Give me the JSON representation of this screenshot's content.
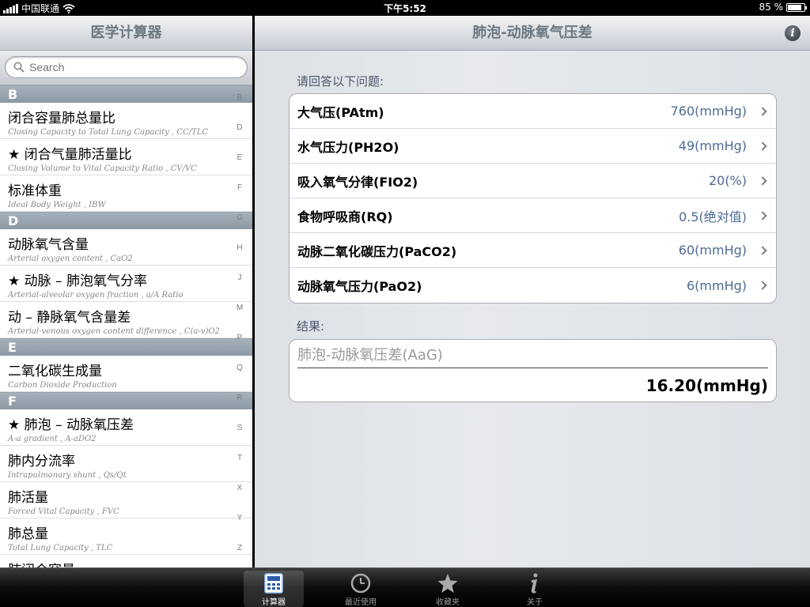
{
  "status": {
    "carrier": "中国联通",
    "time": "下午5:52",
    "battery": "85 %",
    "battery_level": 0.85
  },
  "master": {
    "title": "医学计算器",
    "search_placeholder": "Search",
    "sections": [
      {
        "letter": "B",
        "items": [
          {
            "title": "闭合容量肺总量比",
            "subtitle": "Closing Capacity to Total Lung Capacity , CC/TLC"
          },
          {
            "title": "★ 闭合气量肺活量比",
            "subtitle": "Closing Volume to Vital Capacity Ratio , CV/VC"
          },
          {
            "title": "标准体重",
            "subtitle": "Ideal Body Weight , IBW"
          }
        ]
      },
      {
        "letter": "D",
        "items": [
          {
            "title": "动脉氧气含量",
            "subtitle": "Arterial oxygen content , CaO2"
          },
          {
            "title": "★ 动脉 – 肺泡氧气分率",
            "subtitle": "Arterial-alveolar oxygen fraction , a/A Ratio"
          },
          {
            "title": "动 – 静脉氧气含量差",
            "subtitle": "Arterial-venous oxygen content difference , C(a-v)O2"
          }
        ]
      },
      {
        "letter": "E",
        "items": [
          {
            "title": "二氧化碳生成量",
            "subtitle": "Carbon Dioxide Production"
          }
        ]
      },
      {
        "letter": "F",
        "items": [
          {
            "title": "★ 肺泡 – 动脉氧压差",
            "subtitle": "A-a gradient , A-aDO2"
          },
          {
            "title": "肺内分流率",
            "subtitle": "Intrapulmonary shunt , Qs/Qt"
          },
          {
            "title": "肺活量",
            "subtitle": "Forced Vital Capacity , FVC"
          },
          {
            "title": "肺总量",
            "subtitle": "Total Lung Capacity , TLC"
          },
          {
            "title": "肺闭合容量",
            "subtitle": ""
          }
        ]
      }
    ],
    "index_letters": [
      "B",
      "D",
      "E",
      "F",
      "G",
      "H",
      "J",
      "M",
      "P",
      "Q",
      "R",
      "S",
      "T",
      "X",
      "Y",
      "Z"
    ]
  },
  "detail": {
    "title": "肺泡-动脉氧气压差",
    "questions_label": "请回答以下问题:",
    "inputs": [
      {
        "label": "大气压(PAtm)",
        "value": "760(mmHg)"
      },
      {
        "label": "水气压力(PH2O)",
        "value": "49(mmHg)"
      },
      {
        "label": "吸入氧气分律(FIO2)",
        "value": "20(%)"
      },
      {
        "label": "食物呼吸商(RQ)",
        "value": "0.5(绝对值)"
      },
      {
        "label": "动脉二氧化碳压力(PaCO2)",
        "value": "60(mmHg)"
      },
      {
        "label": "动脉氧气压力(PaO2)",
        "value": "6(mmHg)"
      }
    ],
    "result_label": "结果:",
    "result_name": "肺泡-动脉氧压差(AaG)",
    "result_value": "16.20(mmHg)"
  },
  "tabs": [
    {
      "label": "计算器",
      "icon": "calculator-icon",
      "selected": true
    },
    {
      "label": "最近使用",
      "icon": "clock-icon",
      "selected": false
    },
    {
      "label": "收藏夹",
      "icon": "star-icon",
      "selected": false
    },
    {
      "label": "关于",
      "icon": "info-icon",
      "selected": false
    }
  ]
}
